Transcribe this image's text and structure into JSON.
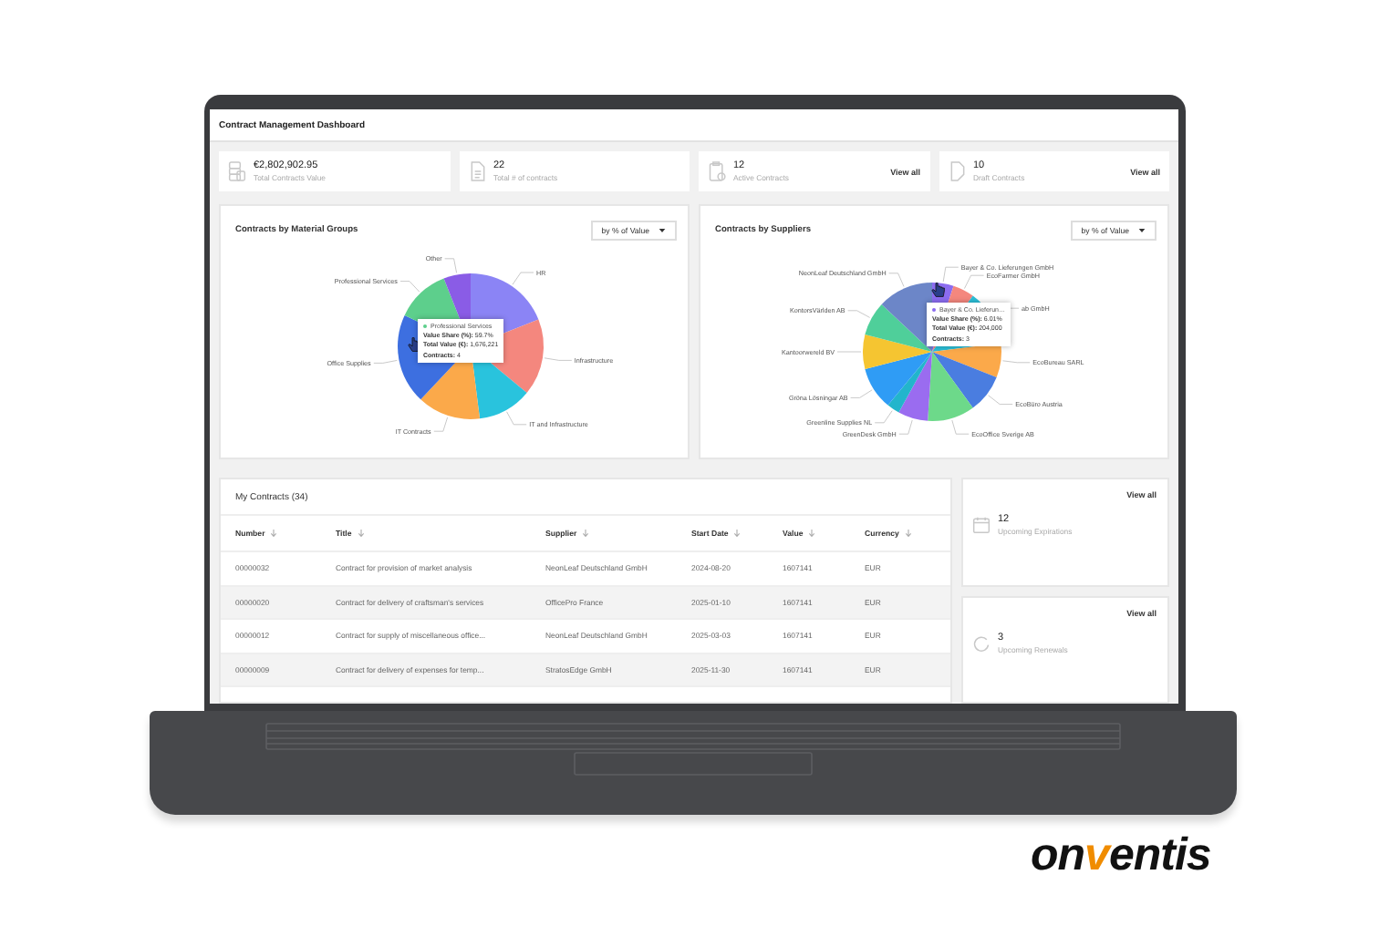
{
  "window": {
    "title": "Contract Management Dashboard"
  },
  "kpis": [
    {
      "kind": "stack",
      "value": "€2,802,902.95",
      "label": "Total Contracts Value"
    },
    {
      "kind": "document",
      "value": "22",
      "label": "Total # of contracts"
    },
    {
      "kind": "clipboard",
      "value": "12",
      "label": "Active Contracts",
      "link": "View all"
    },
    {
      "kind": "draft",
      "value": "10",
      "label": "Draft Contracts",
      "link": "View all"
    }
  ],
  "charts": [
    {
      "title": "Contracts by Material Groups",
      "dropdown": "by % of Value",
      "slices": [
        {
          "label": "Other",
          "color": "#8a5ce6"
        },
        {
          "label": "HR",
          "color": "#8b84f5"
        },
        {
          "label": "Professional Services",
          "color": "#5dcf8c"
        },
        {
          "label": "Infrastructure",
          "color": "#f4877e"
        },
        {
          "label": "Office Supplies",
          "color": "#3d6fe0"
        },
        {
          "label": "IT and Infrastructure",
          "color": "#29c3dd"
        },
        {
          "label": "IT Contracts",
          "color": "#fba94a"
        }
      ],
      "tooltip": {
        "name": "Professional Services",
        "lines": [
          "**Value Share (%):** 59.7%",
          "**Total Value (€):** 1,676,221",
          "**Contracts:** 4"
        ]
      }
    },
    {
      "title": "Contracts by Suppliers",
      "dropdown": "by % of Value",
      "slices": [
        {
          "label": "Bayer & Co. Lieferungen GmbH",
          "color": "#8b6cf0"
        },
        {
          "label": "NeonLeaf Deutschland GmbH",
          "color": "#6c86c8"
        },
        {
          "label": "EcoFarmer GmbH",
          "color": "#f4877e"
        },
        {
          "label": "ab GmbH",
          "color": "#2bbfd8"
        },
        {
          "label": "KontorsVärlden AB",
          "color": "#4fcf9a"
        },
        {
          "label": "Kantoorwereld BV",
          "color": "#f5c531"
        },
        {
          "label": "EcoBureau SARL",
          "color": "#fba94a"
        },
        {
          "label": "Gröna Lösningar AB",
          "color": "#2f9cf5"
        },
        {
          "label": "EcoBüro Austria",
          "color": "#4a7de0"
        },
        {
          "label": "Greenline Supplies NL",
          "color": "#22b5cc"
        },
        {
          "label": "GreenDesk GmbH",
          "color": "#9a6cf0"
        },
        {
          "label": "EcoOffice Sverige AB",
          "color": "#6dd98a"
        }
      ],
      "tooltip": {
        "name": "Bayer & Co. Lieferun…",
        "lines": [
          "**Value Share (%):** 6.01%",
          "**Total Value (€):** 204,000",
          "**Contracts:** 3"
        ]
      }
    }
  ],
  "table": {
    "title": "My Contracts (34)",
    "columns": [
      "Number",
      "Title",
      "Supplier",
      "Start Date",
      "Value",
      "Currency"
    ],
    "rows": [
      {
        "selected": false,
        "cells": [
          "00000032",
          "Contract for provision of market analysis",
          "NeonLeaf Deutschland GmbH",
          "2024-08-20",
          "1607141",
          "EUR"
        ]
      },
      {
        "selected": true,
        "cells": [
          "00000020",
          "Contract for delivery of craftsman's services",
          "OfficePro France",
          "2025-01-10",
          "1607141",
          "EUR"
        ]
      },
      {
        "selected": false,
        "cells": [
          "00000012",
          "Contract for supply of miscellaneous office...",
          "NeonLeaf Deutschland GmbH",
          "2025-03-03",
          "1607141",
          "EUR"
        ]
      },
      {
        "selected": true,
        "cells": [
          "00000009",
          "Contract for delivery of expenses for temp...",
          "StratosEdge GmbH",
          "2025-11-30",
          "1607141",
          "EUR"
        ]
      }
    ]
  },
  "side_cards": [
    {
      "kind": "calendar",
      "link": "View all",
      "value": "12",
      "label": "Upcoming Expirations"
    },
    {
      "kind": "renew",
      "link": "View all",
      "value": "3",
      "label": "Upcoming Renewals"
    }
  ],
  "brand": {
    "before": "on",
    "accent": "v",
    "after": "entis"
  }
}
